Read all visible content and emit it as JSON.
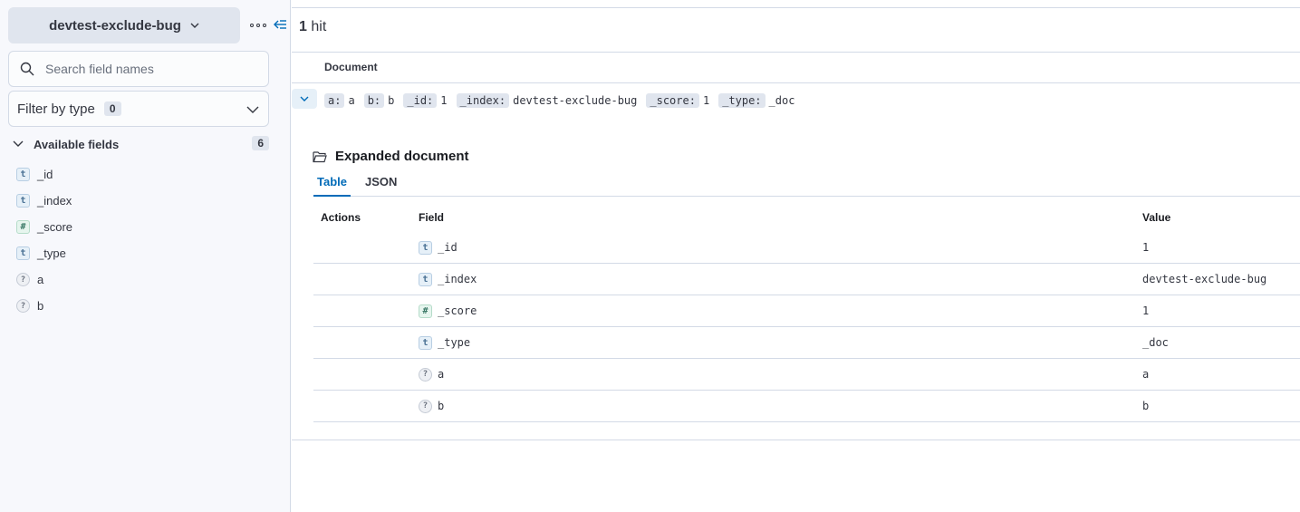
{
  "sidebar": {
    "data_view": "devtest-exclude-bug",
    "search": {
      "placeholder": "Search field names",
      "value": ""
    },
    "filter": {
      "label": "Filter by type",
      "count": "0"
    },
    "available": {
      "label": "Available fields",
      "count": "6"
    },
    "fields": [
      {
        "type": "t",
        "name": "_id"
      },
      {
        "type": "t",
        "name": "_index"
      },
      {
        "type": "#",
        "name": "_score"
      },
      {
        "type": "?",
        "name": "_type"
      },
      {
        "type": "?",
        "name": "a"
      },
      {
        "type": "?",
        "name": "b"
      }
    ]
  },
  "main": {
    "hits_count": "1",
    "hits_label": "hit",
    "document_header": "Document",
    "summary": [
      {
        "key": "a:",
        "value": "a"
      },
      {
        "key": "b:",
        "value": "b"
      },
      {
        "key": "_id:",
        "value": "1"
      },
      {
        "key": "_index:",
        "value": "devtest-exclude-bug"
      },
      {
        "key": "_score:",
        "value": "1"
      },
      {
        "key": "_type:",
        "value": "_doc"
      }
    ],
    "expanded": {
      "title": "Expanded document",
      "tabs": [
        "Table",
        "JSON"
      ],
      "columns": {
        "actions": "Actions",
        "field": "Field",
        "value": "Value"
      },
      "rows": [
        {
          "type": "t",
          "field": "_id",
          "value": "1"
        },
        {
          "type": "t",
          "field": "_index",
          "value": "devtest-exclude-bug"
        },
        {
          "type": "#",
          "field": "_score",
          "value": "1"
        },
        {
          "type": "t",
          "field": "_type",
          "value": "_doc"
        },
        {
          "type": "?",
          "field": "a",
          "value": "a"
        },
        {
          "type": "?",
          "field": "b",
          "value": "b"
        }
      ]
    }
  },
  "colors": {
    "accent": "#006bb8",
    "border": "#d3dae6",
    "sidebar_bg": "#f7f8fc"
  }
}
